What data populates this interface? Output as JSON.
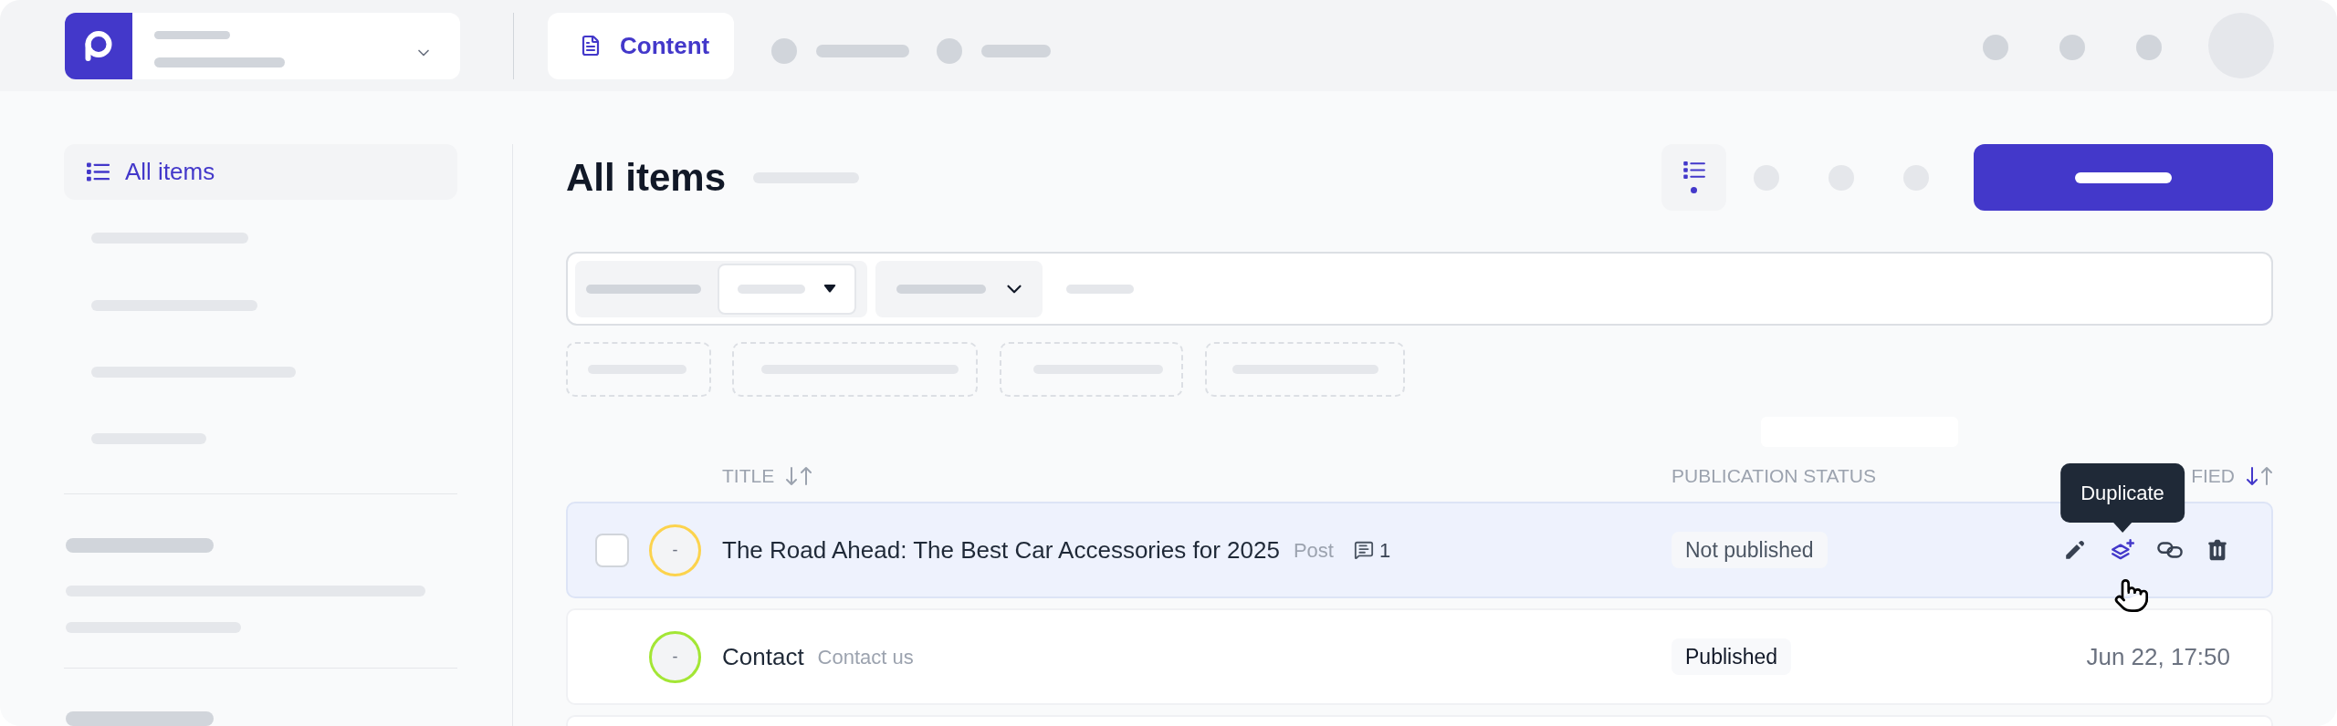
{
  "top_nav": {
    "tabs": [
      {
        "label": "Content",
        "selected": true
      }
    ]
  },
  "sidebar": {
    "items": [
      {
        "label": "All items",
        "selected": true
      }
    ]
  },
  "header": {
    "title": "All items",
    "view_toggle": {
      "selected": true
    }
  },
  "table": {
    "columns": [
      {
        "label": "TITLE",
        "sortable": true,
        "sorted": false
      },
      {
        "label": "PUBLICATION STATUS",
        "sortable": false
      },
      {
        "label": "FIED",
        "sortable": true,
        "sorted": true
      }
    ],
    "rows": [
      {
        "hovered": true,
        "checked": false,
        "indicator": "-",
        "color": "#fcd34d",
        "title": "The Road Ahead: The Best Car Accessories for 2025",
        "secondary": "Post",
        "comments": "1",
        "status": {
          "label": "Not published",
          "published": false
        },
        "actions": [
          {
            "kind": "edit",
            "hovered": false
          },
          {
            "kind": "duplicate",
            "hovered": true,
            "tooltip": "Duplicate"
          },
          {
            "kind": "link",
            "hovered": false
          },
          {
            "kind": "delete",
            "hovered": false
          }
        ]
      },
      {
        "hovered": false,
        "checked": false,
        "indicator": "-",
        "color": "#a3e635",
        "title": "Contact",
        "secondary": "Contact us",
        "status": {
          "label": "Published",
          "published": true
        },
        "modified": "Jun 22, 17:50"
      }
    ]
  }
}
